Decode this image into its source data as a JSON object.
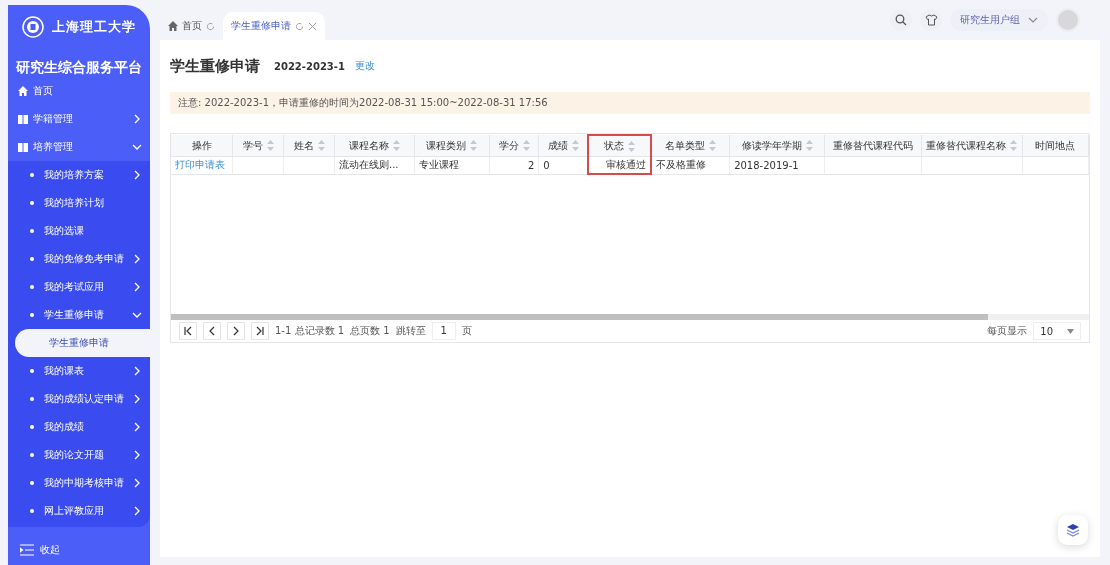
{
  "sidebar": {
    "logo_text": "上海理工大学",
    "platform_title": "研究生综合服务平台",
    "items": [
      {
        "kind": "home",
        "label": "首页"
      },
      {
        "kind": "section",
        "label": "学籍管理",
        "expanded": false
      },
      {
        "kind": "section",
        "label": "培养管理",
        "expanded": true,
        "children": [
          {
            "label": "我的培养方案",
            "expanded": false
          },
          {
            "label": "我的培养计划"
          },
          {
            "label": "我的选课"
          },
          {
            "label": "我的免修免考申请",
            "expanded": false
          },
          {
            "label": "我的考试应用",
            "expanded": false
          },
          {
            "label": "学生重修申请",
            "expanded": true,
            "children": [
              {
                "label": "学生重修申请",
                "selected": true
              }
            ]
          },
          {
            "label": "我的课表",
            "expanded": false
          },
          {
            "label": "我的成绩认定申请",
            "expanded": false
          },
          {
            "label": "我的成绩",
            "expanded": false
          },
          {
            "label": "我的论文开题",
            "expanded": false
          },
          {
            "label": "我的中期考核申请",
            "expanded": false
          },
          {
            "label": "网上评教应用",
            "expanded": false
          }
        ]
      }
    ],
    "collapse_label": "收起"
  },
  "tabs": [
    {
      "label": "首页",
      "selected": false,
      "closable": false
    },
    {
      "label": "学生重修申请",
      "selected": true,
      "closable": true
    }
  ],
  "header": {
    "user_group": "研究生用户组"
  },
  "page": {
    "title": "学生重修申请",
    "term": "2022-2023-1",
    "change_link": "更改",
    "notice": "注意: 2022-2023-1，申请重修的时间为2022-08-31 15:00~2022-08-31 17:56"
  },
  "table": {
    "columns": [
      {
        "label": "操作",
        "sortable": false,
        "highlighted": false
      },
      {
        "label": "学号",
        "sortable": true,
        "highlighted": false
      },
      {
        "label": "姓名",
        "sortable": true,
        "highlighted": false
      },
      {
        "label": "课程名称",
        "sortable": true,
        "highlighted": false
      },
      {
        "label": "课程类别",
        "sortable": true,
        "highlighted": false
      },
      {
        "label": "学分",
        "sortable": true,
        "highlighted": false
      },
      {
        "label": "成绩",
        "sortable": true,
        "highlighted": false
      },
      {
        "label": "状态",
        "sortable": true,
        "highlighted": true
      },
      {
        "label": "名单类型",
        "sortable": true,
        "highlighted": false
      },
      {
        "label": "修读学年学期",
        "sortable": true,
        "highlighted": false
      },
      {
        "label": "重修替代课程代码",
        "sortable": false,
        "highlighted": false
      },
      {
        "label": "重修替代课程名称",
        "sortable": true,
        "highlighted": false
      },
      {
        "label": "时间地点",
        "sortable": false,
        "highlighted": false
      }
    ],
    "rows": [
      {
        "cells": [
          {
            "text": "打印申请表",
            "kind": "link"
          },
          {},
          {},
          {
            "text": "流动在线则..."
          },
          {
            "text": "专业课程"
          },
          {
            "text": "2",
            "kind": "number"
          },
          {
            "text": "0"
          },
          {
            "text": "审核通过",
            "kind": "number"
          },
          {
            "text": "不及格重修"
          },
          {
            "text": "2018-2019-1"
          },
          {},
          {},
          {}
        ]
      }
    ]
  },
  "pager": {
    "summary": "1-1 总记录数 1",
    "pages": "总页数 1",
    "goto_label": "跳转至",
    "page": "1",
    "page_unit": "页",
    "page_size_label": "每页显示",
    "page_size": "10"
  }
}
